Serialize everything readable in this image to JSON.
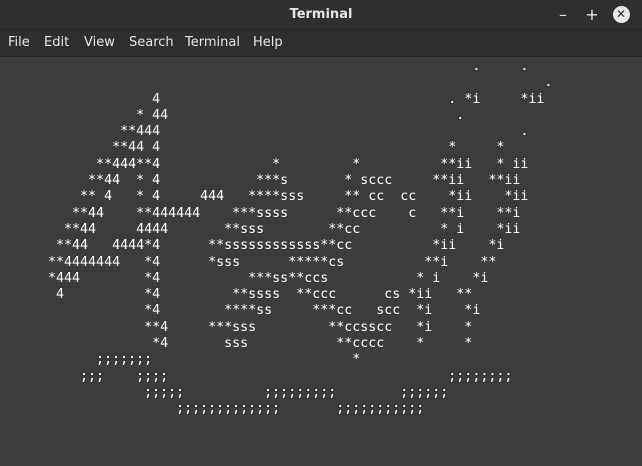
{
  "window": {
    "title": "Terminal",
    "controls": {
      "minimize": "–",
      "maximize": "+",
      "close": "✕"
    }
  },
  "menu": {
    "items": [
      "File",
      "Edit",
      "View",
      "Search",
      "Terminal",
      "Help"
    ]
  },
  "terminal": {
    "colors": {
      "background": "#3c3c3c",
      "foreground": "#ffffff"
    },
    "ascii_art": "                                                          .     .\n                                                                   .\n                  4                                    . *i     *ii\n                * 44                                    .\n              **444                                             .\n             **44 4                                    *     *\n           **444**4              *         *          **ii   * ii\n          **44  * 4            ***s       * sccc     **ii   **ii\n         ** 4   * 4     444   ****sss     ** cc  cc    *ii    *ii\n        **44    **444444    ***ssss      **ccc    c   **i    **i\n       **44     4444       **sss        **cc          * i    *ii\n      **44   4444*4      **ssssssssssss**cc          *ii    *i\n     **4444444   *4      *sss      *****cs          **i    **\n     *444        *4           ***ss**ccs           * i    *i\n      4          *4         **ssss  **ccc      cs *ii   **\n                 *4        ****ss     ***cc   scc  *i    *i\n                 **4     ***sss         **ccsscc   *i    *\n                  *4       sss           **cccc    *     *\n           ;;;;;;;                         *\n         ;;;    ;;;;                                   ;;;;;;;;\n                 ;;;;;          ;;;;;;;;;        ;;;;;;\n                     ;;;;;;;;;;;;;       ;;;;;;;;;;;"
  }
}
